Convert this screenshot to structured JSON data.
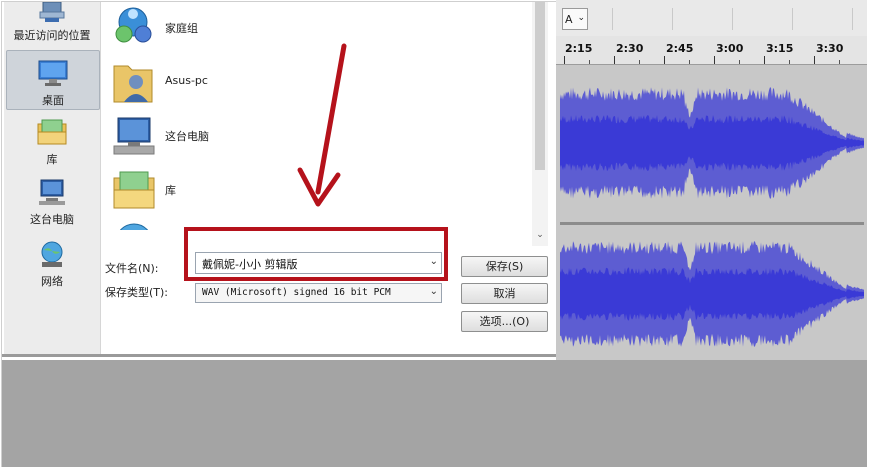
{
  "places": [
    {
      "label": "最近访问的位置",
      "icon": "recent-places-icon"
    },
    {
      "label": "桌面",
      "icon": "desktop-icon",
      "selected": true
    },
    {
      "label": "库",
      "icon": "libraries-icon"
    },
    {
      "label": "这台电脑",
      "icon": "this-pc-icon"
    },
    {
      "label": "网络",
      "icon": "network-icon"
    }
  ],
  "files": [
    {
      "name": "家庭组",
      "icon": "homegroup-icon"
    },
    {
      "name": "Asus-pc",
      "icon": "user-folder-icon"
    },
    {
      "name": "这台电脑",
      "icon": "this-pc-icon"
    },
    {
      "name": "库",
      "icon": "libraries-icon"
    },
    {
      "name": "",
      "icon": "network-icon"
    }
  ],
  "form": {
    "filename_label": "文件名(N):",
    "filename_value": "戴佩妮-小小 剪辑版",
    "filetype_label": "保存类型(T):",
    "filetype_value": "WAV (Microsoft) signed 16 bit PCM"
  },
  "buttons": {
    "save": "保存(S)",
    "cancel": "取消",
    "options": "选项...(O)"
  },
  "audio": {
    "track_selector": "A",
    "timeline_labels": [
      "2:15",
      "2:30",
      "2:45",
      "3:00",
      "3:15",
      "3:30"
    ],
    "waveform_color": "#3a3ad6",
    "background_color": "#c8c8c8"
  },
  "annotation": {
    "highlight_color": "#b5121b"
  }
}
